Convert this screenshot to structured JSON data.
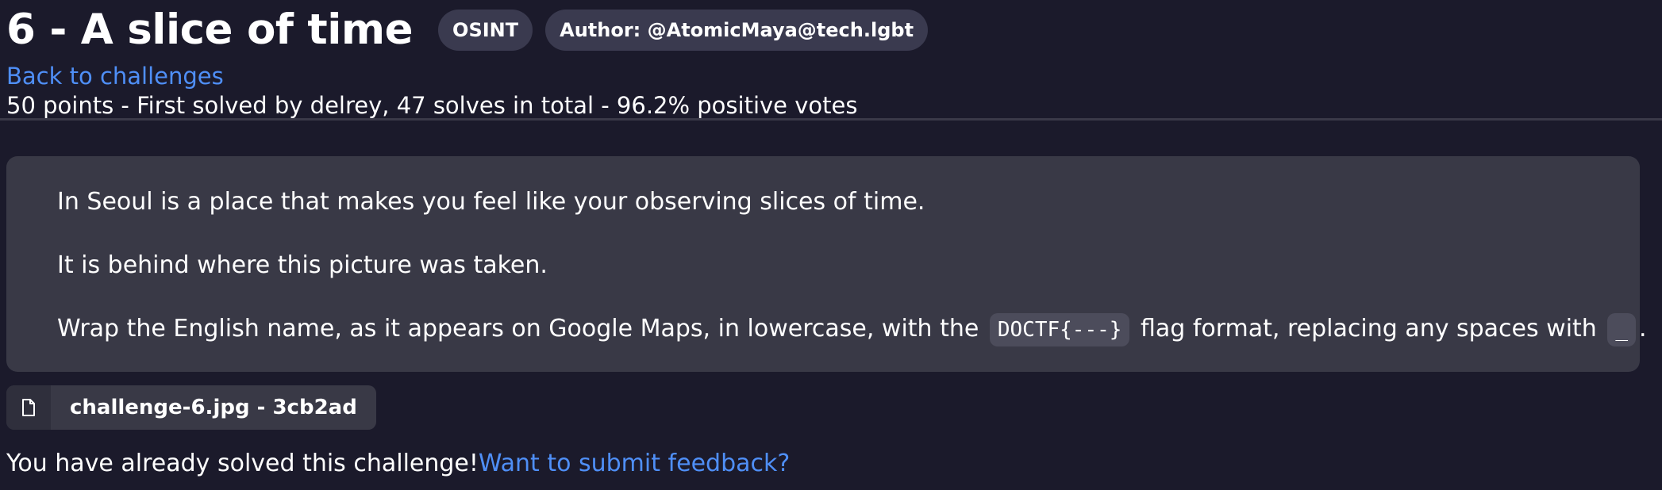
{
  "challenge": {
    "title": "6 - A slice of time",
    "category": "OSINT",
    "author": "Author: @AtomicMaya@tech.lgbt",
    "back_link": "Back to challenges",
    "meta": "50 points - First solved by delrey, 47 solves in total - 96.2% positive votes"
  },
  "description": {
    "line1": "In Seoul is a place that makes you feel like your observing slices of time.",
    "line2": "It is behind where this picture was taken.",
    "line3_part1": "Wrap the English name, as it appears on Google Maps, in lowercase, with the",
    "flag_format": "DOCTF{---}",
    "line3_part2": "flag format, replacing any spaces with",
    "space_replacement": "_",
    "line3_end": "."
  },
  "attachment": {
    "icon": "file-icon",
    "label": "challenge-6.jpg - 3cb2ad"
  },
  "status": {
    "solved_text": "You have already solved this challenge!",
    "feedback_link": "Want to submit feedback?"
  },
  "colors": {
    "background": "#1b1a2b",
    "panel": "#393946",
    "badge": "#3a3a4f",
    "link": "#4f8ff7"
  }
}
